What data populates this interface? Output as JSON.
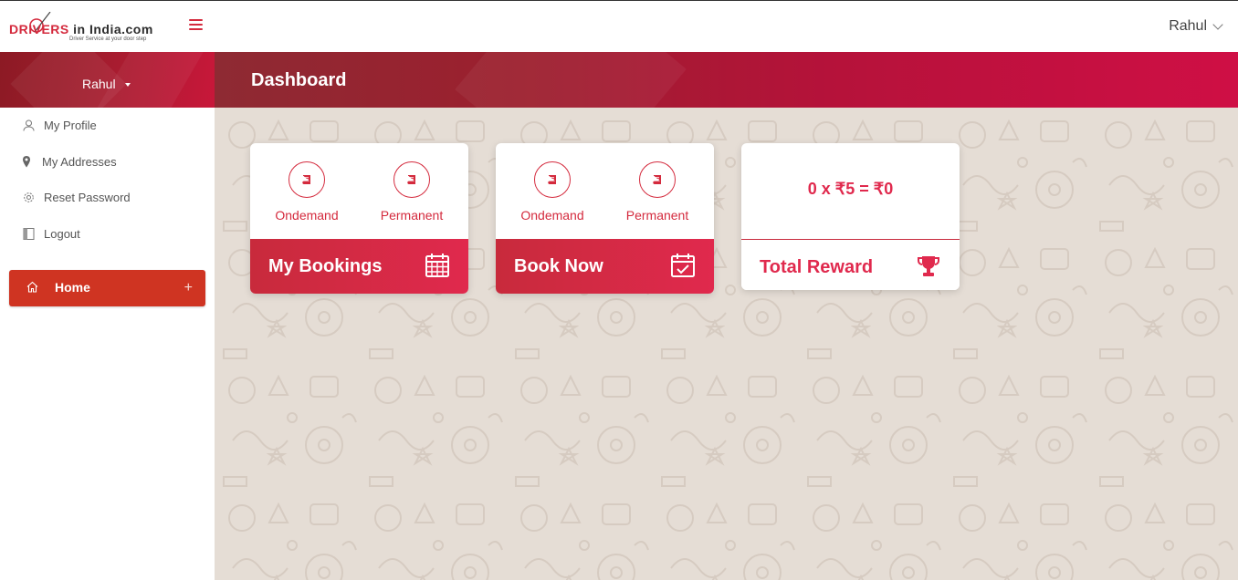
{
  "brand": {
    "name_red": "DRIVERS",
    "name_dark": " in India.com",
    "tagline": "Driver Service at your door step"
  },
  "header": {
    "user_name": "Rahul"
  },
  "sidebar": {
    "user_name": "Rahul",
    "items": [
      {
        "label": "My Profile",
        "icon": "user-icon"
      },
      {
        "label": "My Addresses",
        "icon": "map-marker-icon"
      },
      {
        "label": "Reset Password",
        "icon": "gear-icon"
      },
      {
        "label": "Logout",
        "icon": "logout-icon"
      }
    ],
    "home_label": "Home",
    "home_expand": "+"
  },
  "page": {
    "title": "Dashboard"
  },
  "cards": [
    {
      "options": [
        "Ondemand",
        "Permanent"
      ],
      "title": "My Bookings",
      "icon": "calendar-icon"
    },
    {
      "options": [
        "Ondemand",
        "Permanent"
      ],
      "title": "Book Now",
      "icon": "calendar-check-icon"
    }
  ],
  "reward": {
    "value": "0 x ₹5 = ₹0",
    "title": "Total Reward",
    "icon": "trophy-icon"
  },
  "colors": {
    "accent": "#d42a3d",
    "home_button": "#cf3422",
    "content_bg": "#e5ddd5"
  }
}
